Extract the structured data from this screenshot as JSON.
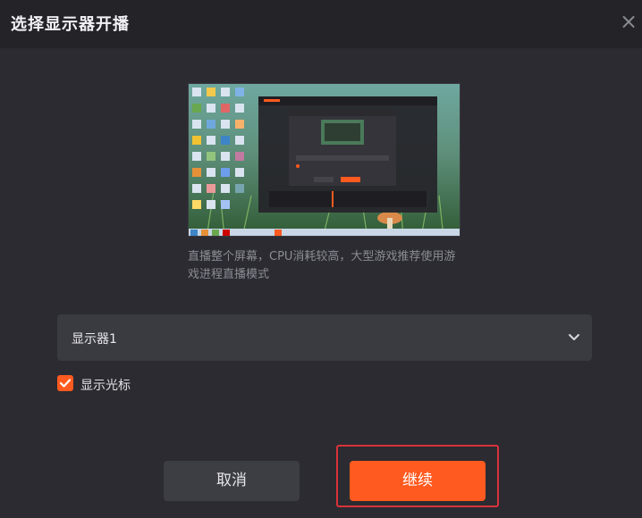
{
  "dialog": {
    "title": "选择显示器开播",
    "close_icon": "close-icon"
  },
  "preview": {
    "description": "直播整个屏幕，CPU消耗较高，大型游戏推荐使用游戏进程直播模式"
  },
  "monitor_select": {
    "value": "显示器1",
    "icon": "chevron-down-icon"
  },
  "show_cursor": {
    "label": "显示光标",
    "checked": true
  },
  "buttons": {
    "cancel": "取消",
    "continue": "继续"
  },
  "colors": {
    "accent": "#ff5a1f",
    "background": "#2b2b31",
    "titlebar": "#232328",
    "highlight": "#d9323a"
  }
}
